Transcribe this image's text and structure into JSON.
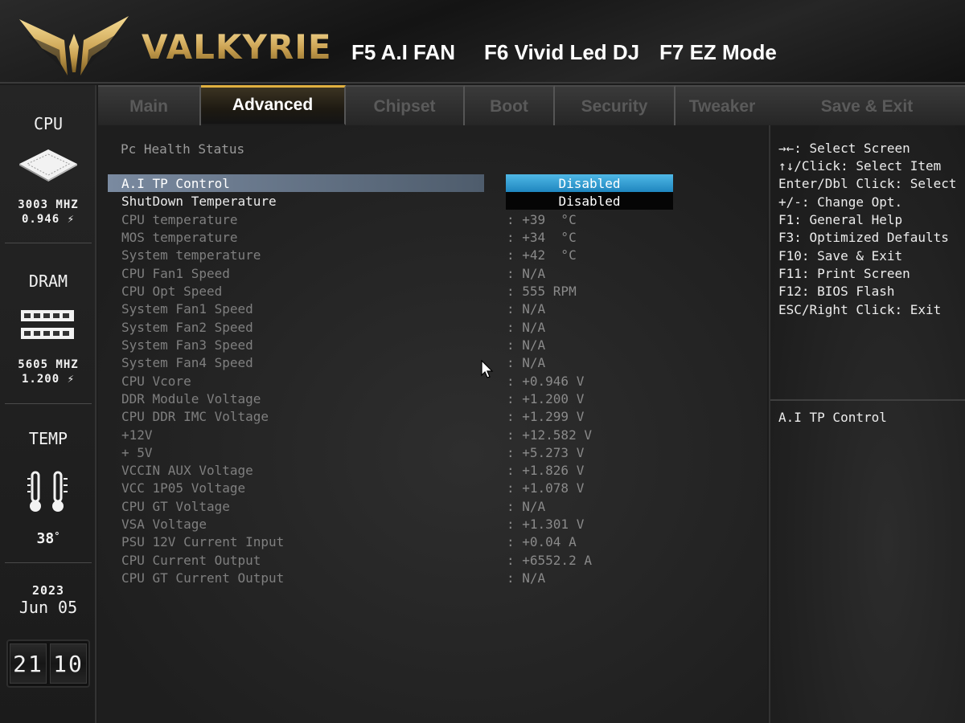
{
  "header": {
    "brand": "VALKYRIE",
    "hotkeys": [
      "F5 A.I FAN",
      "F6 Vivid Led DJ",
      "F7 EZ Mode"
    ],
    "accent_color": "#c9a050"
  },
  "sidebar": {
    "cpu": {
      "label": "CPU",
      "freq": "3003 MHZ",
      "volt": "0.946"
    },
    "dram": {
      "label": "DRAM",
      "freq": "5605 MHZ",
      "volt": "1.200"
    },
    "temp": {
      "label": "TEMP",
      "value": "38"
    },
    "date": {
      "year": "2023",
      "day": "Jun 05"
    },
    "clock": {
      "hours": "21",
      "minutes": "10"
    }
  },
  "tabs": [
    "Main",
    "Advanced",
    "Chipset",
    "Boot",
    "Security",
    "Tweaker"
  ],
  "active_tab": "Advanced",
  "save_exit_tab": "Save & Exit",
  "main": {
    "section_title": "Pc Health Status",
    "options": [
      {
        "label": "A.I TP Control",
        "value": "Disabled"
      },
      {
        "label": "ShutDown Temperature",
        "value": "Disabled"
      }
    ],
    "readings": [
      {
        "label": "CPU temperature",
        "value": ": +39  °C"
      },
      {
        "label": "MOS temperature",
        "value": ": +34  °C"
      },
      {
        "label": "System temperature",
        "value": ": +42  °C"
      },
      {
        "label": "CPU Fan1 Speed",
        "value": ": N/A"
      },
      {
        "label": "CPU Opt Speed",
        "value": ": 555 RPM"
      },
      {
        "label": "System Fan1 Speed",
        "value": ": N/A"
      },
      {
        "label": "System Fan2 Speed",
        "value": ": N/A"
      },
      {
        "label": "System Fan3 Speed",
        "value": ": N/A"
      },
      {
        "label": "System Fan4 Speed",
        "value": ": N/A"
      },
      {
        "label": "CPU Vcore",
        "value": ": +0.946 V"
      },
      {
        "label": "DDR Module Voltage",
        "value": ": +1.200 V"
      },
      {
        "label": "CPU DDR IMC Voltage",
        "value": ": +1.299 V"
      },
      {
        "label": "+12V",
        "value": ": +12.582 V"
      },
      {
        "label": "+ 5V",
        "value": ": +5.273 V"
      },
      {
        "label": "VCCIN AUX Voltage",
        "value": ": +1.826 V"
      },
      {
        "label": "VCC 1P05 Voltage",
        "value": ": +1.078 V"
      },
      {
        "label": "CPU GT Voltage",
        "value": ": N/A"
      },
      {
        "label": "VSA Voltage",
        "value": ": +1.301 V"
      },
      {
        "label": "PSU 12V Current Input",
        "value": ": +0.04 A"
      },
      {
        "label": "CPU Current Output",
        "value": ": +6552.2 A"
      },
      {
        "label": "CPU GT Current Output",
        "value": ": N/A"
      }
    ]
  },
  "help": {
    "lines": [
      "→←: Select Screen",
      "↑↓/Click: Select Item",
      "Enter/Dbl Click: Select",
      "+/-: Change Opt.",
      "F1: General Help",
      "F3: Optimized Defaults",
      "F10: Save & Exit",
      "F11: Print Screen",
      "F12: BIOS Flash",
      "ESC/Right Click: Exit"
    ],
    "description": "A.I TP Control"
  }
}
